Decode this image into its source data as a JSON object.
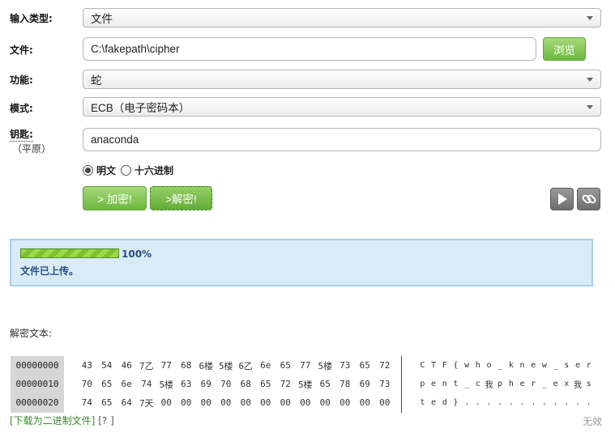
{
  "form": {
    "input_type": {
      "label": "输入类型:",
      "value": "文件"
    },
    "file": {
      "label": "文件:",
      "value": "C:\\fakepath\\cipher",
      "browse_label": "浏览"
    },
    "function": {
      "label": "功能:",
      "value": "蛇"
    },
    "mode": {
      "label": "模式:",
      "value": "ECB（电子密码本）"
    },
    "key": {
      "label": "钥匙:",
      "sublabel": "（平原）",
      "value": "anaconda"
    },
    "key_format": {
      "options": [
        "明文",
        "十六进制"
      ],
      "selected": "明文"
    },
    "encrypt_label": "> 加密!",
    "decrypt_label": ">解密!",
    "icons": [
      "play-icon",
      "link-icon"
    ]
  },
  "status": {
    "progress": 100,
    "progress_text": "100%",
    "message": "文件已上传。"
  },
  "result": {
    "title": "解密文本:",
    "rows": [
      {
        "address": "00000000",
        "bytes": [
          "43",
          "54",
          "46",
          "7乙",
          "77",
          "68",
          "6楼",
          "5楼",
          "6乙",
          "6e",
          "65",
          "77",
          "5楼",
          "73",
          "65",
          "72"
        ],
        "ascii": [
          "C",
          "T",
          "F",
          "{",
          "w",
          "h",
          "o",
          "_",
          "k",
          "n",
          "e",
          "w",
          "_",
          "s",
          "e",
          "r"
        ]
      },
      {
        "address": "00000010",
        "bytes": [
          "70",
          "65",
          "6e",
          "74",
          "5楼",
          "63",
          "69",
          "70",
          "68",
          "65",
          "72",
          "5楼",
          "65",
          "78",
          "69",
          "73"
        ],
        "ascii": [
          "p",
          "e",
          "n",
          "t",
          "_",
          "c",
          "我",
          "p",
          "h",
          "e",
          "r",
          "_",
          "e",
          "x",
          "我",
          "s"
        ]
      },
      {
        "address": "00000020",
        "bytes": [
          "74",
          "65",
          "64",
          "7天",
          "00",
          "00",
          "00",
          "00",
          "00",
          "00",
          "00",
          "00",
          "00",
          "00",
          "00",
          "00"
        ],
        "ascii": [
          "t",
          "e",
          "d",
          "}",
          ".",
          ".",
          ".",
          ".",
          ".",
          ".",
          ".",
          ".",
          ".",
          ".",
          ".",
          "."
        ]
      }
    ],
    "download_link": "[下载为二进制文件]",
    "help_link": "[? ]",
    "invalid_label": "无效"
  },
  "colors": {
    "accent_green": "#6cb83f",
    "status_bg": "#d8ebf7",
    "link": "#3a8a2a"
  }
}
